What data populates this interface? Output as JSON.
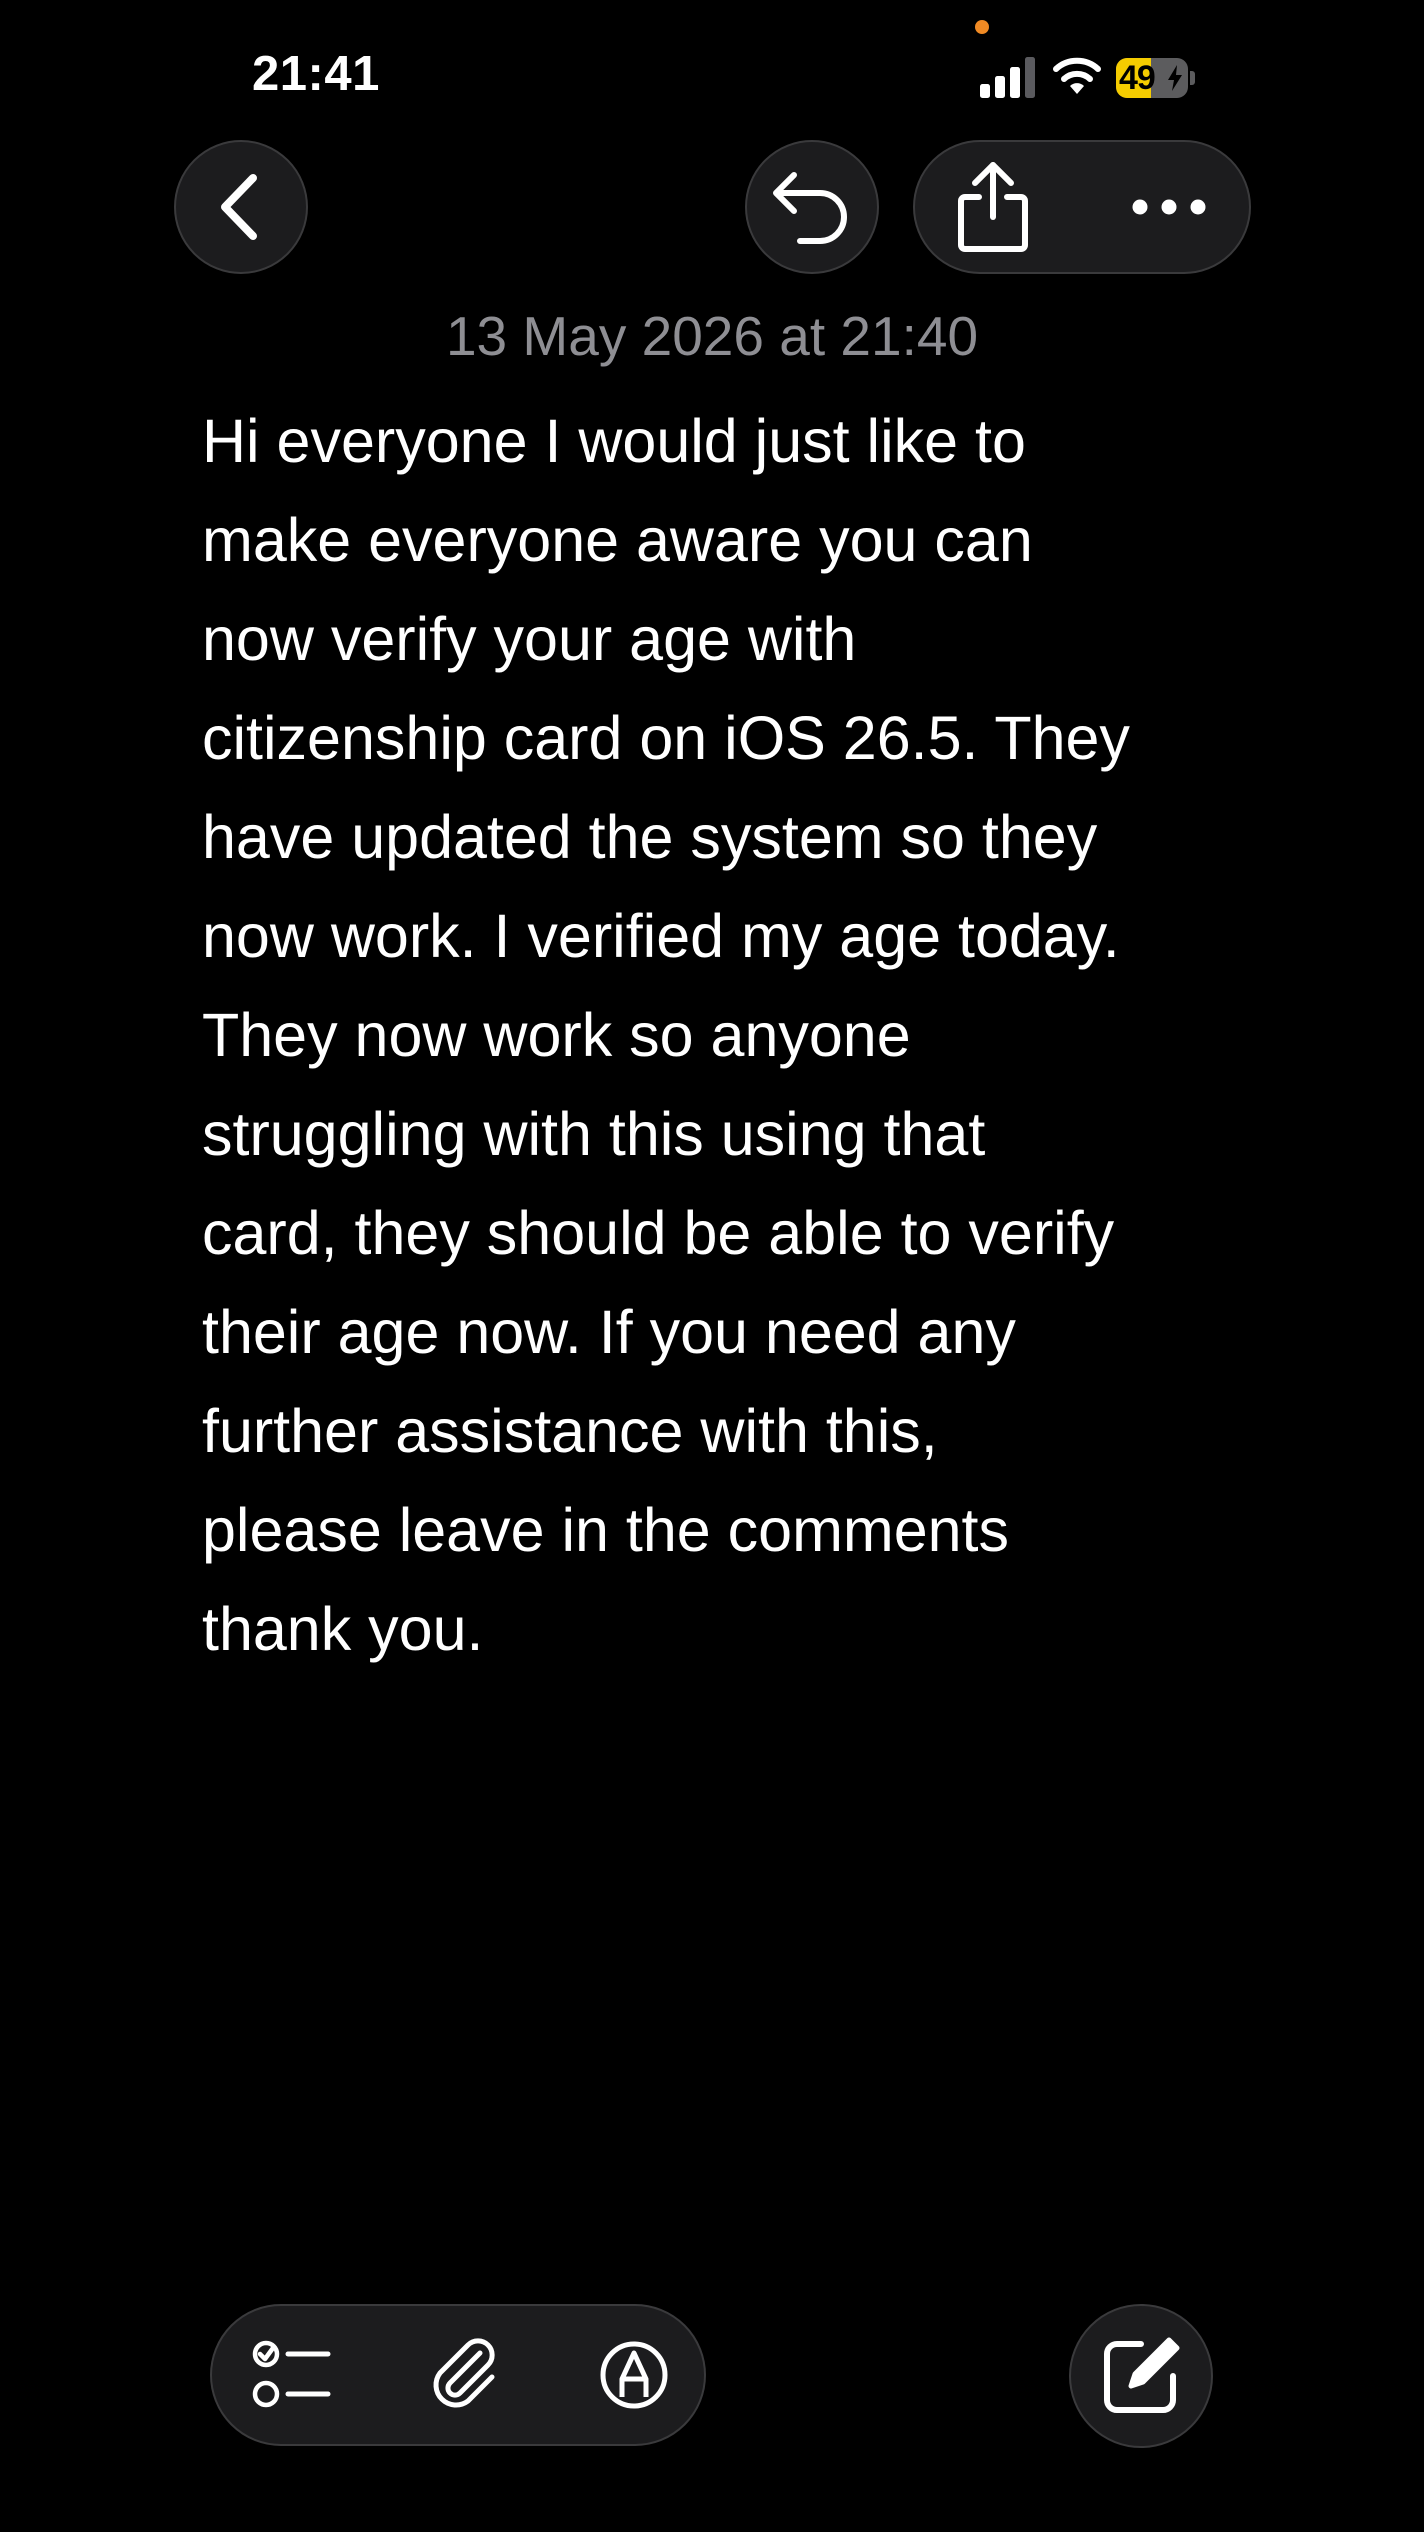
{
  "status_bar": {
    "time": "21:41",
    "battery_level": "49",
    "battery_fraction": 0.49,
    "icons": [
      "privacy-indicator-dot",
      "cellular-signal-icon",
      "wifi-icon",
      "battery-charging-icon"
    ]
  },
  "nav": {
    "icons": [
      "chevron-left-icon",
      "undo-icon",
      "share-icon",
      "ellipsis-icon"
    ]
  },
  "note": {
    "date": "13 May 2026 at 21:40",
    "lines": [
      "Hi everyone I would just like to",
      "make everyone aware you can",
      "now verify your age with",
      "citizenship card on iOS 26.5. They",
      "have updated the system so they",
      "now work. I verified my age today.",
      "They now work so anyone",
      "struggling with this using that",
      "card, they should be able to verify",
      "their age now. If you need any",
      "further assistance with this,",
      "please leave in the comments",
      "thank you."
    ]
  },
  "toolbar": {
    "icons": [
      "checklist-icon",
      "paperclip-icon",
      "markup-pen-icon",
      "compose-icon"
    ]
  },
  "colors": {
    "background": "#000000",
    "text": "#ffffff",
    "date": "#8e8e93",
    "button_fill": "#1c1c1e",
    "button_border": "#3a3a3c",
    "battery_accent": "#f5cc00",
    "privacy_dot": "#f08a24"
  }
}
